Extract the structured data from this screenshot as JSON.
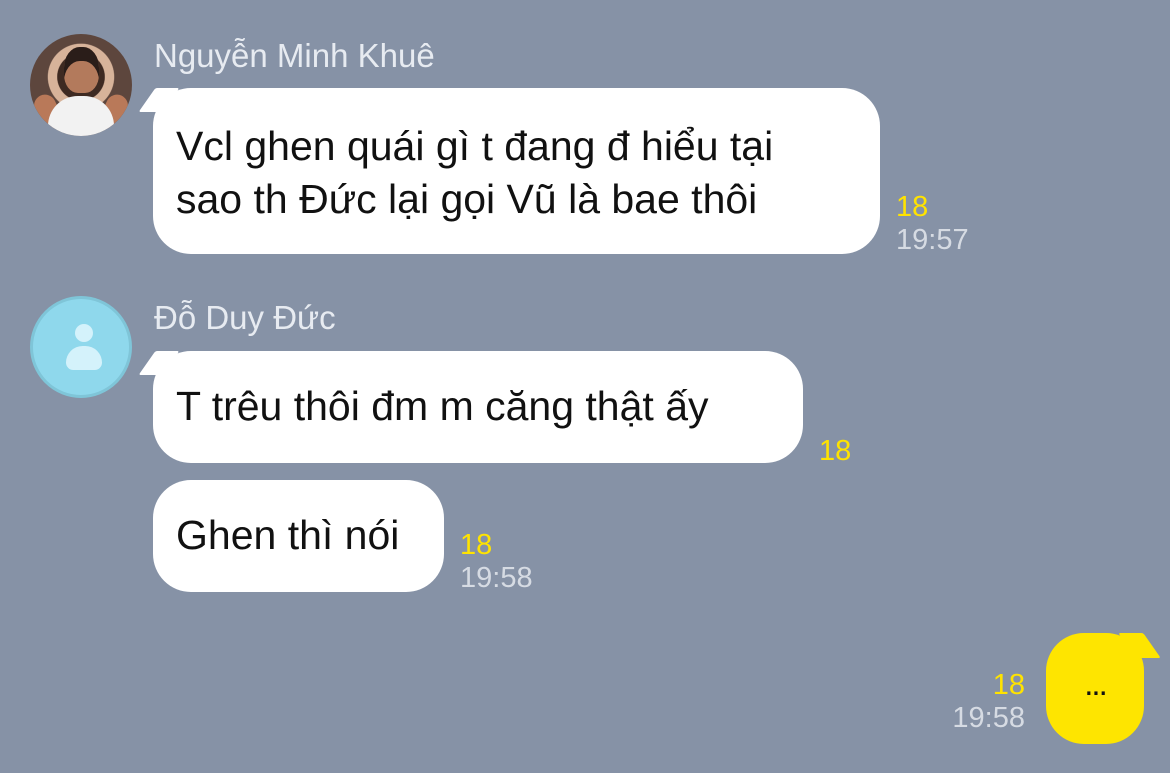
{
  "chat": {
    "messages": [
      {
        "sender": "Nguyễn Minh Khuê",
        "lines": [
          "Vcl ghen quái gì t đang đ hiểu tại",
          "sao th Đức lại gọi Vũ là bae thôi"
        ],
        "count": "18",
        "time": "19:57"
      },
      {
        "sender": "Đỗ Duy Đức",
        "text": "T trêu thôi đm m căng thật ấy",
        "count": "18"
      },
      {
        "text": "Ghen thì nói",
        "count": "18",
        "time": "19:58"
      },
      {
        "text": "...",
        "count": "18",
        "time": "19:58"
      }
    ]
  }
}
